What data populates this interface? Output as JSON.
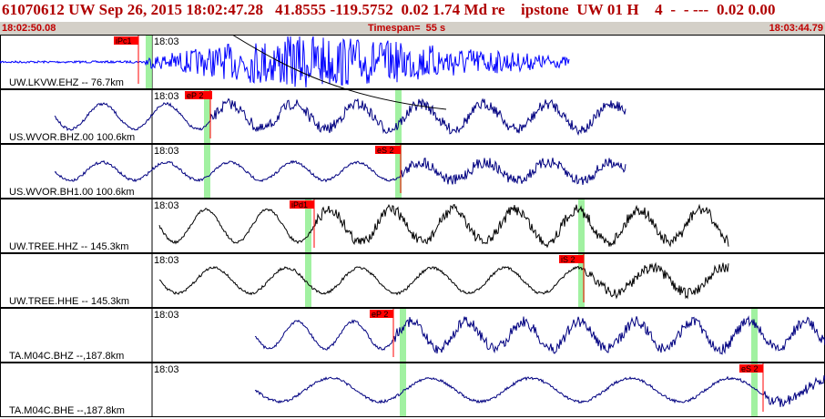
{
  "header": {
    "title": "61070612 UW Sep 26, 2015 18:02:47.28   41.8555 -119.5752  0.02 1.74 Md re    ipstone  UW 01 H    4  -  - ---  0.02 0.00",
    "start_time": "18:02:50.08",
    "timespan": "Timespan=  55 s",
    "end_time": "18:03:44.79"
  },
  "time_tick_label": "18:03",
  "colors": {
    "title": "#b00000",
    "subbar_bg": "#d4d0c8",
    "pick_marker": "#ff0000",
    "pick_highlight": "#90ee90",
    "trace_blue": "#0000ff",
    "trace_navy": "#000080",
    "trace_black": "#000000"
  },
  "traces": [
    {
      "label": "UW.LKVW.EHZ -- 76.7km",
      "color": "trace_blue",
      "style": "quake",
      "picks": [
        {
          "label": "iPc1"
        }
      ]
    },
    {
      "label": "US.WVOR.BHZ.00 100.6km",
      "color": "trace_navy",
      "style": "wave",
      "picks": [
        {
          "label": "eP 2"
        }
      ]
    },
    {
      "label": "US.WVOR.BH1.00 100.6km",
      "color": "trace_navy",
      "style": "wave",
      "picks": [
        {
          "label": "eS 2"
        }
      ]
    },
    {
      "label": "UW.TREE.HHZ -- 145.3km",
      "color": "trace_black",
      "style": "wave",
      "picks": [
        {
          "label": "iPd1"
        }
      ]
    },
    {
      "label": "UW.TREE.HHE -- 145.3km",
      "color": "trace_black",
      "style": "wave",
      "picks": [
        {
          "label": "iS 2"
        }
      ]
    },
    {
      "label": "TA.M04C.BHZ --,187.8km",
      "color": "trace_navy",
      "style": "wave",
      "picks": [
        {
          "label": "eP 2"
        }
      ]
    },
    {
      "label": "TA.M04C.BHE --,187.8km",
      "color": "trace_navy",
      "style": "wave",
      "picks": [
        {
          "label": "eS 2"
        }
      ]
    }
  ]
}
